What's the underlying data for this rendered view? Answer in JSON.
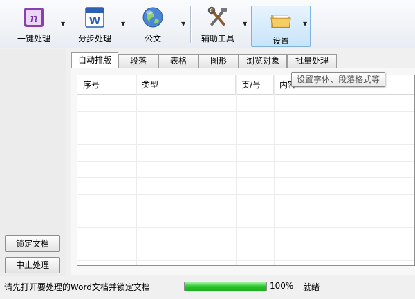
{
  "toolbar": {
    "buttons": [
      {
        "label": "一键处理",
        "icon": "onenote-icon"
      },
      {
        "label": "分步处理",
        "icon": "word-icon"
      },
      {
        "label": "公文",
        "icon": "globe-icon"
      },
      {
        "label": "辅助工具",
        "icon": "tools-icon"
      },
      {
        "label": "设置",
        "icon": "folder-icon"
      }
    ]
  },
  "left_panel": {
    "lock_label": "锁定文档",
    "stop_label": "中止处理"
  },
  "tabs": [
    {
      "label": "自动排版",
      "active": true
    },
    {
      "label": "段落"
    },
    {
      "label": "表格"
    },
    {
      "label": "图形"
    },
    {
      "label": "浏览对象"
    },
    {
      "label": "批量处理"
    }
  ],
  "table": {
    "columns": [
      "序号",
      "类型",
      "页/号",
      "内容"
    ]
  },
  "tooltip": "设置字体、段落格式等",
  "status": {
    "message": "请先打开要处理的Word文档并锁定文档",
    "progress": 100,
    "progress_text": "100%",
    "state": "就绪"
  },
  "colors": {
    "progress": "#27c427",
    "active_tab_bg": "#ffffff",
    "toolbar_active": "#c7e4fa"
  }
}
